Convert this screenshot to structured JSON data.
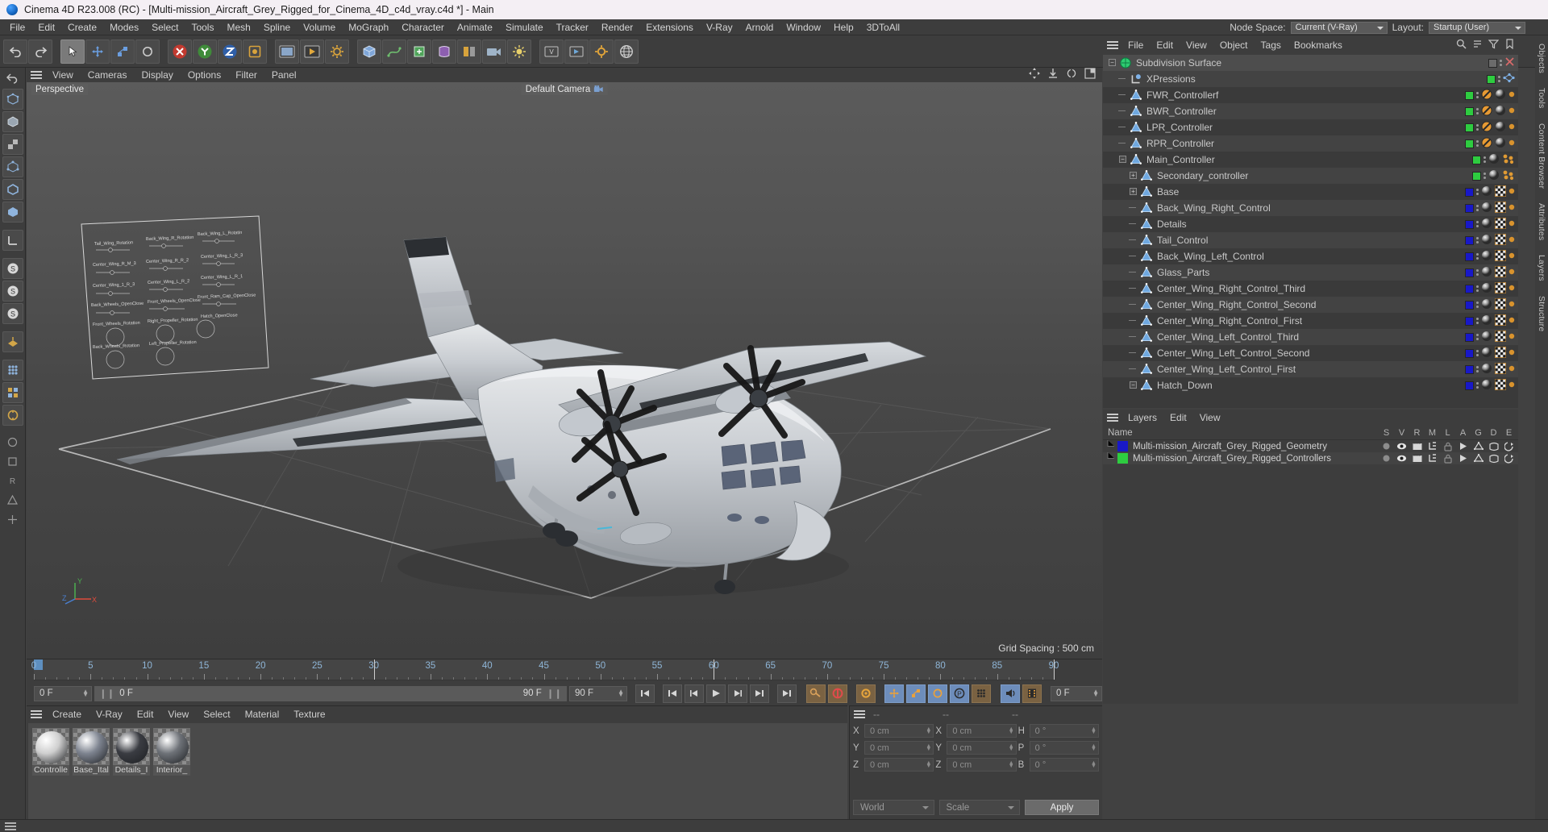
{
  "window": {
    "title": "Cinema 4D R23.008 (RC) - [Multi-mission_Aircraft_Grey_Rigged_for_Cinema_4D_c4d_vray.c4d *] - Main",
    "logo_icon": "cinema4d-logo-icon"
  },
  "menubar": {
    "items": [
      "File",
      "Edit",
      "Create",
      "Modes",
      "Select",
      "Tools",
      "Mesh",
      "Spline",
      "Volume",
      "MoGraph",
      "Character",
      "Animate",
      "Simulate",
      "Tracker",
      "Render",
      "Extensions",
      "V-Ray",
      "Arnold",
      "Window",
      "Help",
      "3DToAll"
    ]
  },
  "topright": {
    "node_space_label": "Node Space:",
    "node_space_value": "Current (V-Ray)",
    "layout_label": "Layout:",
    "layout_value": "Startup (User)"
  },
  "viewport": {
    "menu": [
      "View",
      "Cameras",
      "Display",
      "Options",
      "Filter",
      "Panel"
    ],
    "view_label": "Perspective",
    "camera_label": "Default Camera",
    "grid_spacing": "Grid Spacing : 500 cm",
    "axis": {
      "x": "X",
      "y": "Y",
      "z": "Z"
    },
    "annotation_labels": [
      "Tail_Wing_Rotation",
      "Back_Wing_R_Rotation",
      "Back_Wing_L_Rotatin",
      "Center_Wing_R_M_3",
      "Center_Wing_R_R_2",
      "Center_Wing_L_R_3",
      "Center_Wing_1_R_3",
      "Center_Wing_L_R_2",
      "Center_Wing_L_R_1",
      "Back_Wheels_OpenClose",
      "Front_Wheels_OpenClose",
      "Front_Ram_Cap_OpenClose",
      "Front_Wheels_Rotation",
      "Right_Propeller_Rotation",
      "Hatch_OpenClose",
      "Back_Wheels_Rotation",
      "Left_Propeller_Rotation"
    ]
  },
  "timeline": {
    "ticks": [
      0,
      5,
      10,
      15,
      20,
      25,
      30,
      35,
      40,
      45,
      50,
      55,
      60,
      65,
      70,
      75,
      80,
      85,
      90
    ],
    "current_frame": "0 F",
    "current_frame_secondary": "0 F",
    "end_frame": "90 F",
    "end_frame_field": "90 F",
    "preview_frame": "0 F",
    "transport": [
      "go-to-start-icon",
      "previous-keyframe-icon",
      "step-back-icon",
      "play-icon",
      "step-forward-icon",
      "next-keyframe-icon",
      "go-to-end-icon"
    ],
    "record_tools": [
      "autokey-icon",
      "record-active-objects-icon",
      "keyframe-settings-icon",
      "position-key-icon",
      "scale-key-icon",
      "rotation-key-icon",
      "parameter-key-icon",
      "point-level-key-icon"
    ],
    "right_tools": [
      "sound-icon",
      "timeline-icon"
    ]
  },
  "material_manager": {
    "menu": [
      "Create",
      "V-Ray",
      "Edit",
      "View",
      "Select",
      "Material",
      "Texture"
    ],
    "materials": [
      {
        "name": "Controlle",
        "swatch_color": "#cfcfcf"
      },
      {
        "name": "Base_Ital",
        "swatch_color": "#7e8490"
      },
      {
        "name": "Details_I",
        "swatch_color": "#3a3c42"
      },
      {
        "name": "Interior_",
        "swatch_color": "#6e7278"
      }
    ]
  },
  "coordinates": {
    "header": [
      "--",
      "--",
      "--"
    ],
    "rows": [
      {
        "pos_label": "X",
        "pos_value": "0 cm",
        "size_label": "X",
        "size_value": "0 cm",
        "rot_label": "H",
        "rot_value": "0 °"
      },
      {
        "pos_label": "Y",
        "pos_value": "0 cm",
        "size_label": "Y",
        "size_value": "0 cm",
        "rot_label": "P",
        "rot_value": "0 °"
      },
      {
        "pos_label": "Z",
        "pos_value": "0 cm",
        "size_label": "Z",
        "size_value": "0 cm",
        "rot_label": "B",
        "rot_value": "0 °"
      }
    ],
    "coord_system": "World",
    "mode": "Scale",
    "apply_label": "Apply"
  },
  "object_manager": {
    "menu": [
      "File",
      "Edit",
      "View",
      "Object",
      "Tags",
      "Bookmarks"
    ],
    "search_icons": [
      "search-icon",
      "scroll-to-icon",
      "filter-icon",
      "bookmark-icon"
    ],
    "objects": [
      {
        "name": "Subdivision Surface",
        "icon": "subdivision-surface-icon",
        "indent": 0,
        "expander": "minus",
        "dot": "none",
        "tags": [
          "close-x"
        ],
        "selected": true
      },
      {
        "name": "XPressions",
        "icon": "xpresso-icon",
        "indent": 1,
        "expander": "none",
        "dot": "#2ecc40",
        "tags": [
          "xpresso-tag"
        ]
      },
      {
        "name": "FWR_Controllerf",
        "icon": "null-object-icon",
        "indent": 1,
        "expander": "none",
        "dot": "#2ecc40",
        "tags": [
          "protection-tag",
          "material-tag",
          "dot-tag"
        ]
      },
      {
        "name": "BWR_Controller",
        "icon": "null-object-icon",
        "indent": 1,
        "expander": "none",
        "dot": "#2ecc40",
        "tags": [
          "protection-tag",
          "material-tag",
          "dot-tag"
        ]
      },
      {
        "name": "LPR_Controller",
        "icon": "null-object-icon",
        "indent": 1,
        "expander": "none",
        "dot": "#2ecc40",
        "tags": [
          "protection-tag",
          "material-tag",
          "dot-tag"
        ]
      },
      {
        "name": "RPR_Controller",
        "icon": "null-object-icon",
        "indent": 1,
        "expander": "none",
        "dot": "#2ecc40",
        "tags": [
          "protection-tag",
          "material-tag",
          "dot-tag"
        ]
      },
      {
        "name": "Main_Controller",
        "icon": "null-object-icon",
        "indent": 1,
        "expander": "minus",
        "dot": "#2ecc40",
        "tags": [
          "material-tag",
          "dots-tag"
        ]
      },
      {
        "name": "Secondary_controller",
        "icon": "null-object-icon",
        "indent": 2,
        "expander": "plus",
        "dot": "#2ecc40",
        "tags": [
          "material-tag",
          "dots-tag"
        ]
      },
      {
        "name": "Base",
        "icon": "null-object-icon",
        "indent": 2,
        "expander": "plus",
        "dot": "#1818c8",
        "tags": [
          "material-tag",
          "uv-tag",
          "dot-tag"
        ]
      },
      {
        "name": "Back_Wing_Right_Control",
        "icon": "null-object-icon",
        "indent": 2,
        "expander": "none",
        "dot": "#1818c8",
        "tags": [
          "material-tag",
          "uv-tag",
          "dot-tag"
        ]
      },
      {
        "name": "Details",
        "icon": "null-object-icon",
        "indent": 2,
        "expander": "none",
        "dot": "#1818c8",
        "tags": [
          "material-tag",
          "uv-tag",
          "dot-tag"
        ]
      },
      {
        "name": "Tail_Control",
        "icon": "null-object-icon",
        "indent": 2,
        "expander": "none",
        "dot": "#1818c8",
        "tags": [
          "material-tag",
          "uv-tag",
          "dot-tag"
        ]
      },
      {
        "name": "Back_Wing_Left_Control",
        "icon": "null-object-icon",
        "indent": 2,
        "expander": "none",
        "dot": "#1818c8",
        "tags": [
          "material-tag",
          "uv-tag",
          "dot-tag"
        ]
      },
      {
        "name": "Glass_Parts",
        "icon": "null-object-icon",
        "indent": 2,
        "expander": "none",
        "dot": "#1818c8",
        "tags": [
          "material-tag",
          "uv-tag",
          "dot-tag"
        ]
      },
      {
        "name": "Center_Wing_Right_Control_Third",
        "icon": "null-object-icon",
        "indent": 2,
        "expander": "none",
        "dot": "#1818c8",
        "tags": [
          "material-tag",
          "uv-tag",
          "dot-tag"
        ]
      },
      {
        "name": "Center_Wing_Right_Control_Second",
        "icon": "null-object-icon",
        "indent": 2,
        "expander": "none",
        "dot": "#1818c8",
        "tags": [
          "material-tag",
          "uv-tag",
          "dot-tag"
        ]
      },
      {
        "name": "Center_Wing_Right_Control_First",
        "icon": "null-object-icon",
        "indent": 2,
        "expander": "none",
        "dot": "#1818c8",
        "tags": [
          "material-tag",
          "uv-tag",
          "dot-tag"
        ]
      },
      {
        "name": "Center_Wing_Left_Control_Third",
        "icon": "null-object-icon",
        "indent": 2,
        "expander": "none",
        "dot": "#1818c8",
        "tags": [
          "material-tag",
          "uv-tag",
          "dot-tag"
        ]
      },
      {
        "name": "Center_Wing_Left_Control_Second",
        "icon": "null-object-icon",
        "indent": 2,
        "expander": "none",
        "dot": "#1818c8",
        "tags": [
          "material-tag",
          "uv-tag",
          "dot-tag"
        ]
      },
      {
        "name": "Center_Wing_Left_Control_First",
        "icon": "null-object-icon",
        "indent": 2,
        "expander": "none",
        "dot": "#1818c8",
        "tags": [
          "material-tag",
          "uv-tag",
          "dot-tag"
        ]
      },
      {
        "name": "Hatch_Down",
        "icon": "null-object-icon",
        "indent": 2,
        "expander": "minus",
        "dot": "#1818c8",
        "tags": [
          "material-tag",
          "uv-tag",
          "dot-tag"
        ]
      }
    ]
  },
  "layers_manager": {
    "menu": [
      "Layers",
      "Edit",
      "View"
    ],
    "name_header": "Name",
    "columns": [
      "S",
      "V",
      "R",
      "M",
      "L",
      "A",
      "G",
      "D",
      "E"
    ],
    "rows": [
      {
        "name": "Multi-mission_Aircraft_Grey_Rigged_Geometry",
        "color": "#1818c8"
      },
      {
        "name": "Multi-mission_Aircraft_Grey_Rigged_Controllers",
        "color": "#2ecc40"
      }
    ]
  },
  "right_tabs": [
    "Objects",
    "Tools",
    "Content Browser",
    "Attributes",
    "Layers",
    "Structure"
  ],
  "colors": {
    "panel_bg": "#3d3d3d",
    "list_bg": "#3a3a3a",
    "accent_blue": "#6d8dbb",
    "selected_row": "#4d4d4d",
    "green_layer": "#2ecc40",
    "blue_layer": "#1818c8",
    "tick_text": "#8fb6d8"
  }
}
